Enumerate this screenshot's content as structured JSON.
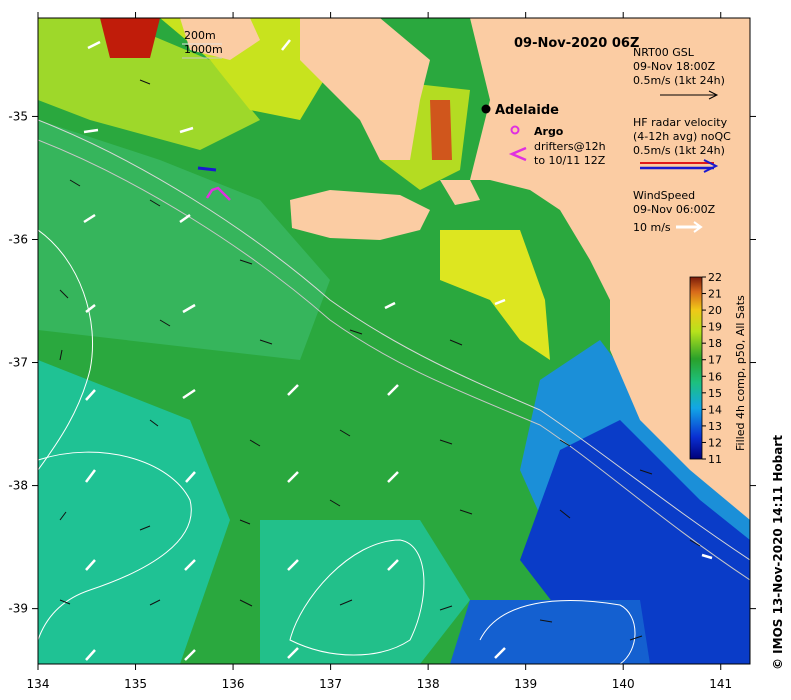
{
  "map": {
    "title": "09-Nov-2020 06Z",
    "lon_ticks": [
      "134",
      "135",
      "136",
      "137",
      "138",
      "139",
      "140",
      "141"
    ],
    "lat_ticks": [
      "-35",
      "-36",
      "-37",
      "-38",
      "-39"
    ],
    "lon_range": [
      134,
      141.3
    ],
    "lat_range": [
      -39.45,
      -34.2
    ],
    "depth_legend": [
      "200m",
      "1000m"
    ],
    "places": [
      {
        "name": "Adelaide"
      }
    ],
    "argo_label": "Argo",
    "drifters_label_1": "drifters@12h",
    "drifters_label_2": "to 10/11 12Z",
    "gsl_legend": [
      "NRT00 GSL",
      "09-Nov 18:00Z",
      "0.5m/s (1kt 24h)"
    ],
    "radar_legend": [
      "HF radar velocity",
      "(4-12h avg) noQC",
      "0.5m/s (1kt 24h)"
    ],
    "wind_legend": [
      "WindSpeed",
      "09-Nov 06:00Z",
      "10 m/s"
    ],
    "colorbar": {
      "ticks": [
        "22",
        "21",
        "20",
        "19",
        "18",
        "17",
        "16",
        "15",
        "14",
        "13",
        "12",
        "11"
      ],
      "min": 11,
      "max": 22,
      "label": "Filled 4h comp, p50, All Sats"
    },
    "credit": "© IMOS 13-Nov-2020 14:11 Hobart",
    "colors": {
      "land": "#fbcca3",
      "cool": "#0a3cc8",
      "mid": "#1fae3c",
      "warm": "#c8e61e",
      "hot": "#b8391c",
      "radar": "#1a1ad0",
      "radar_alt": "#e01a1a",
      "argo": "#e030e0"
    }
  }
}
